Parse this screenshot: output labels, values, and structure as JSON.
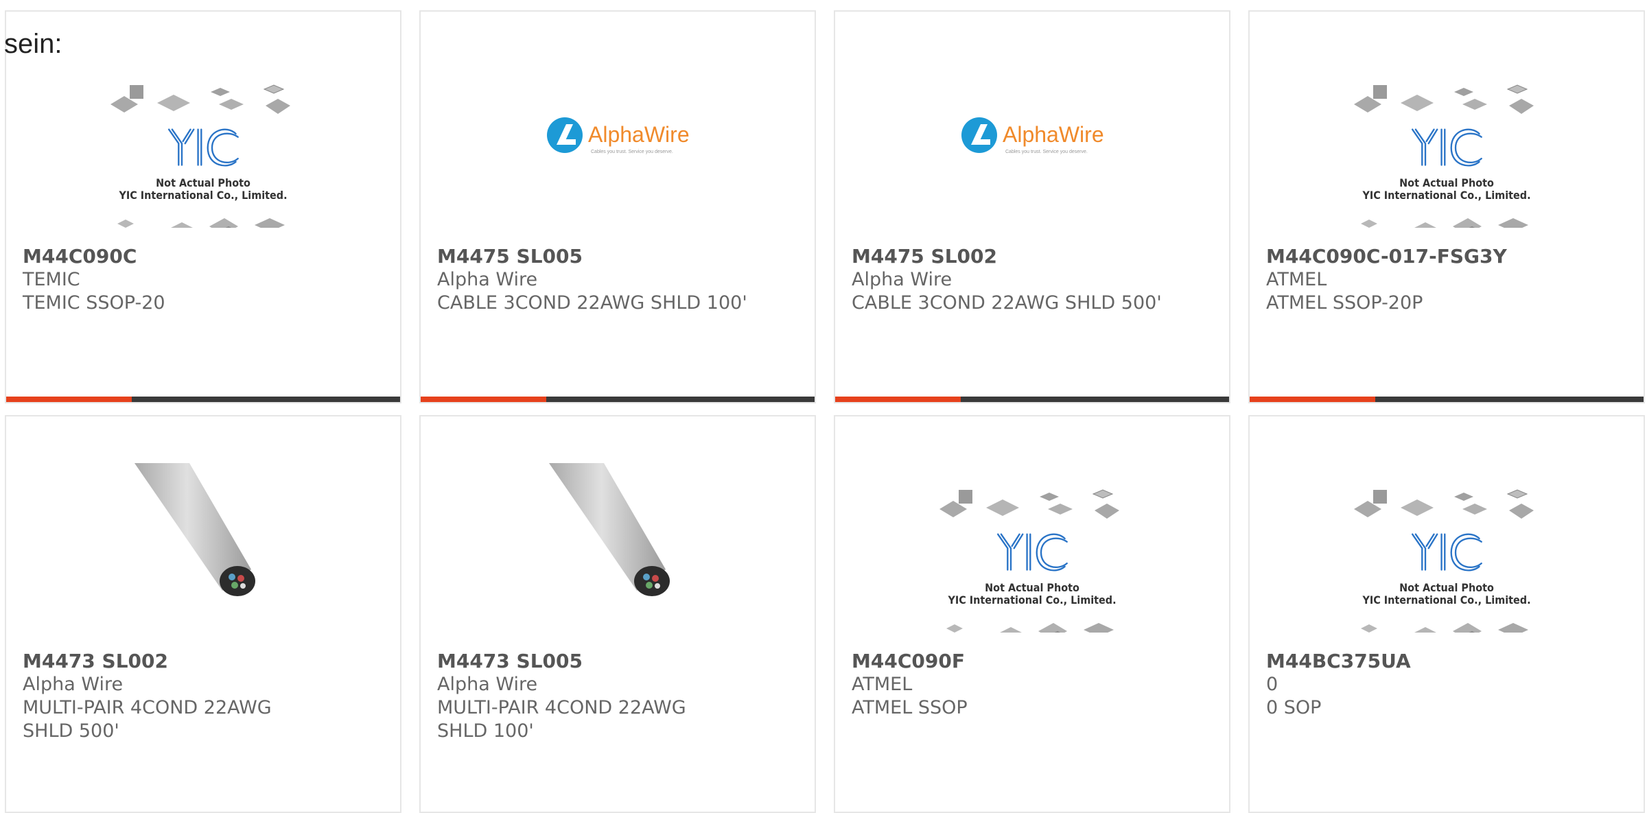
{
  "intro_text": "sein:",
  "colors": {
    "accent": "#e6411c",
    "bar": "#3a3a3a",
    "alpha_orange": "#f08a2b",
    "alpha_blue": "#1d9ad6",
    "yic_blue": "#2a74c7"
  },
  "placeholder": {
    "line1": "Not Actual Photo",
    "line2": "YIC International Co., Limited.",
    "logo": "YIC"
  },
  "alphawire_logo": {
    "name": "AlphaWire",
    "tagline": "Cables you trust. Service you deserve."
  },
  "products": [
    {
      "part": "M44C090C",
      "brand": "TEMIC",
      "description": "TEMIC SSOP-20",
      "image": "yic-placeholder"
    },
    {
      "part": "M4475 SL005",
      "brand": "Alpha Wire",
      "description": "CABLE 3COND 22AWG SHLD 100'",
      "image": "alphawire-logo"
    },
    {
      "part": "M4475 SL002",
      "brand": "Alpha Wire",
      "description": "CABLE 3COND 22AWG SHLD 500'",
      "image": "alphawire-logo"
    },
    {
      "part": "M44C090C-017-FSG3Y",
      "brand": "ATMEL",
      "description": "ATMEL SSOP-20P",
      "image": "yic-placeholder"
    },
    {
      "part": "M4473 SL002",
      "brand": "Alpha Wire",
      "description_line1": "MULTI-PAIR 4COND 22AWG",
      "description_line2": "SHLD 500'",
      "image": "cable-photo"
    },
    {
      "part": "M4473 SL005",
      "brand": "Alpha Wire",
      "description_line1": "MULTI-PAIR 4COND 22AWG",
      "description_line2": "SHLD 100'",
      "image": "cable-photo"
    },
    {
      "part": "M44C090F",
      "brand": "ATMEL",
      "description": "ATMEL SSOP",
      "image": "yic-placeholder"
    },
    {
      "part": "M44BC375UA",
      "brand": "0",
      "description": "0 SOP",
      "image": "yic-placeholder"
    }
  ]
}
